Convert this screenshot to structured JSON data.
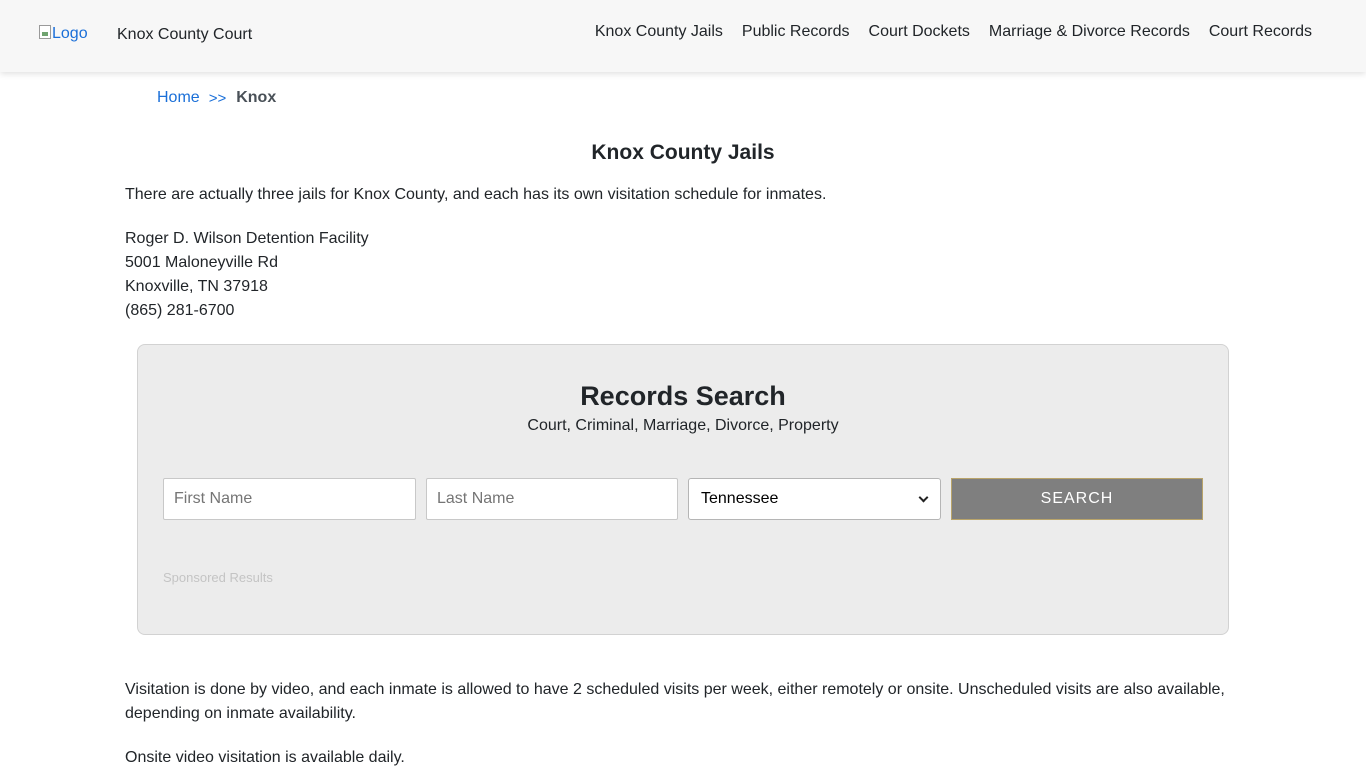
{
  "header": {
    "logo_alt": "Logo",
    "site_name": "Knox County Court",
    "nav": [
      {
        "label": "Knox County Jails"
      },
      {
        "label": "Public Records"
      },
      {
        "label": "Court Dockets"
      },
      {
        "label": "Marriage & Divorce Records"
      },
      {
        "label": "Court Records"
      }
    ]
  },
  "breadcrumb": {
    "home": "Home",
    "separator": ">>",
    "current": "Knox"
  },
  "main": {
    "title": "Knox County Jails",
    "intro": "There are actually three jails for Knox County, and each has its own visitation schedule for inmates.",
    "facility": {
      "name": "Roger D. Wilson Detention Facility",
      "street": "5001 Maloneyville Rd",
      "city": "Knoxville, TN 37918",
      "phone": "(865) 281-6700"
    },
    "visitation": "Visitation is done by video, and each inmate is allowed to have 2 scheduled visits per week, either remotely or onsite. Unscheduled visits are also available, depending on inmate availability.",
    "onsite": "Onsite video visitation is available daily."
  },
  "search": {
    "title": "Records Search",
    "subtitle": "Court, Criminal, Marriage, Divorce, Property",
    "first_name_placeholder": "First Name",
    "last_name_placeholder": "Last Name",
    "state_selected": "Tennessee",
    "button_label": "SEARCH",
    "sponsored": "Sponsored Results"
  },
  "colors": {
    "link": "#1a6fd8",
    "header_bg": "#f7f7f7",
    "search_bg": "#ececec",
    "button_bg": "#7f7f7f"
  }
}
